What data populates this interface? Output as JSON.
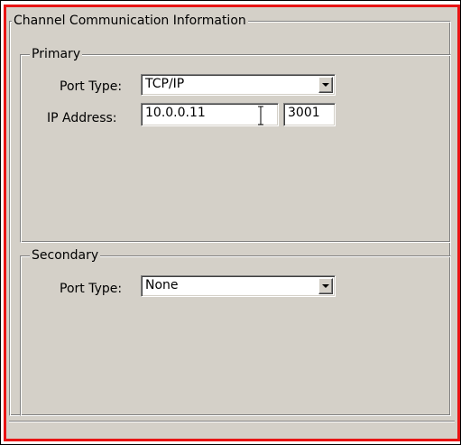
{
  "channel_group": {
    "title": "Channel Communication Information"
  },
  "primary": {
    "title": "Primary",
    "port_type_label": "Port Type:",
    "port_type_value": "TCP/IP",
    "ip_address_label": "IP Address:",
    "ip_address_value": "10.0.0.11",
    "port_value": "3001"
  },
  "secondary": {
    "title": "Secondary",
    "port_type_label": "Port Type:",
    "port_type_value": "None"
  },
  "colors": {
    "border_highlight": "#e81414",
    "panel_background": "#d4d0c8"
  },
  "icons": {
    "dropdown": "chevron-down-icon",
    "text_cursor": "i-beam-cursor-icon"
  }
}
